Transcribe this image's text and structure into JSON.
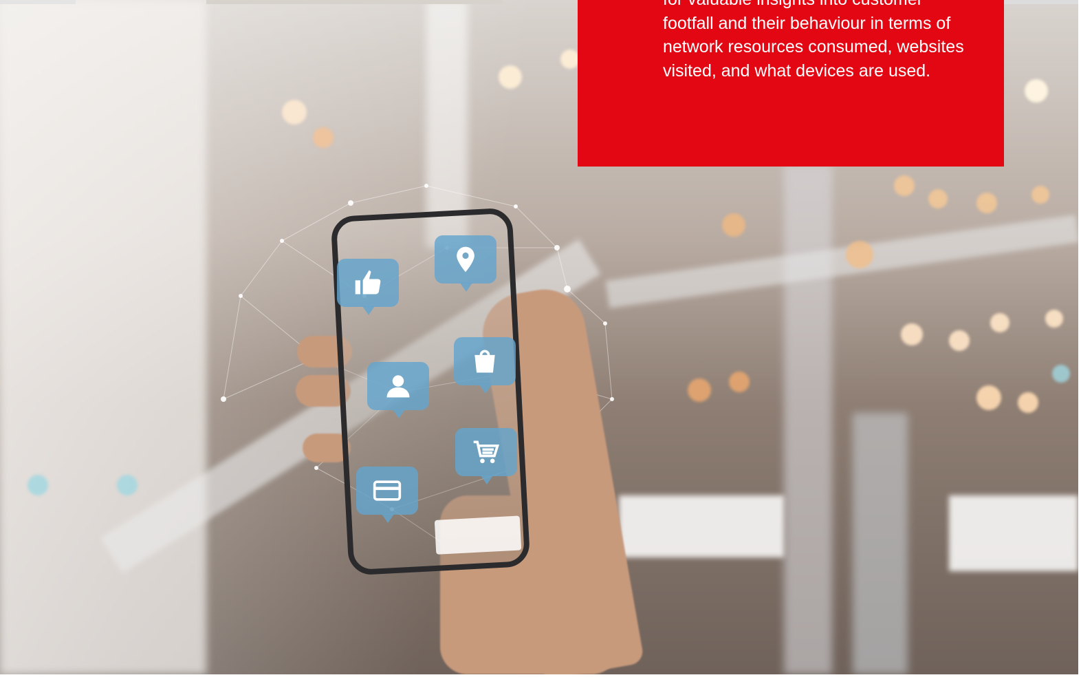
{
  "panel": {
    "text": "for valuable insights into customer footfall and their behaviour in terms of network resources consumed, websites visited, and what devices are used.",
    "background_color": "#e30613",
    "text_color": "#ffffff"
  },
  "photo": {
    "icons": [
      "thumbs-up-icon",
      "location-pin-icon",
      "shopping-bag-icon",
      "user-icon",
      "shopping-cart-icon",
      "credit-card-icon"
    ],
    "bubble_color": "#64a5cd"
  }
}
